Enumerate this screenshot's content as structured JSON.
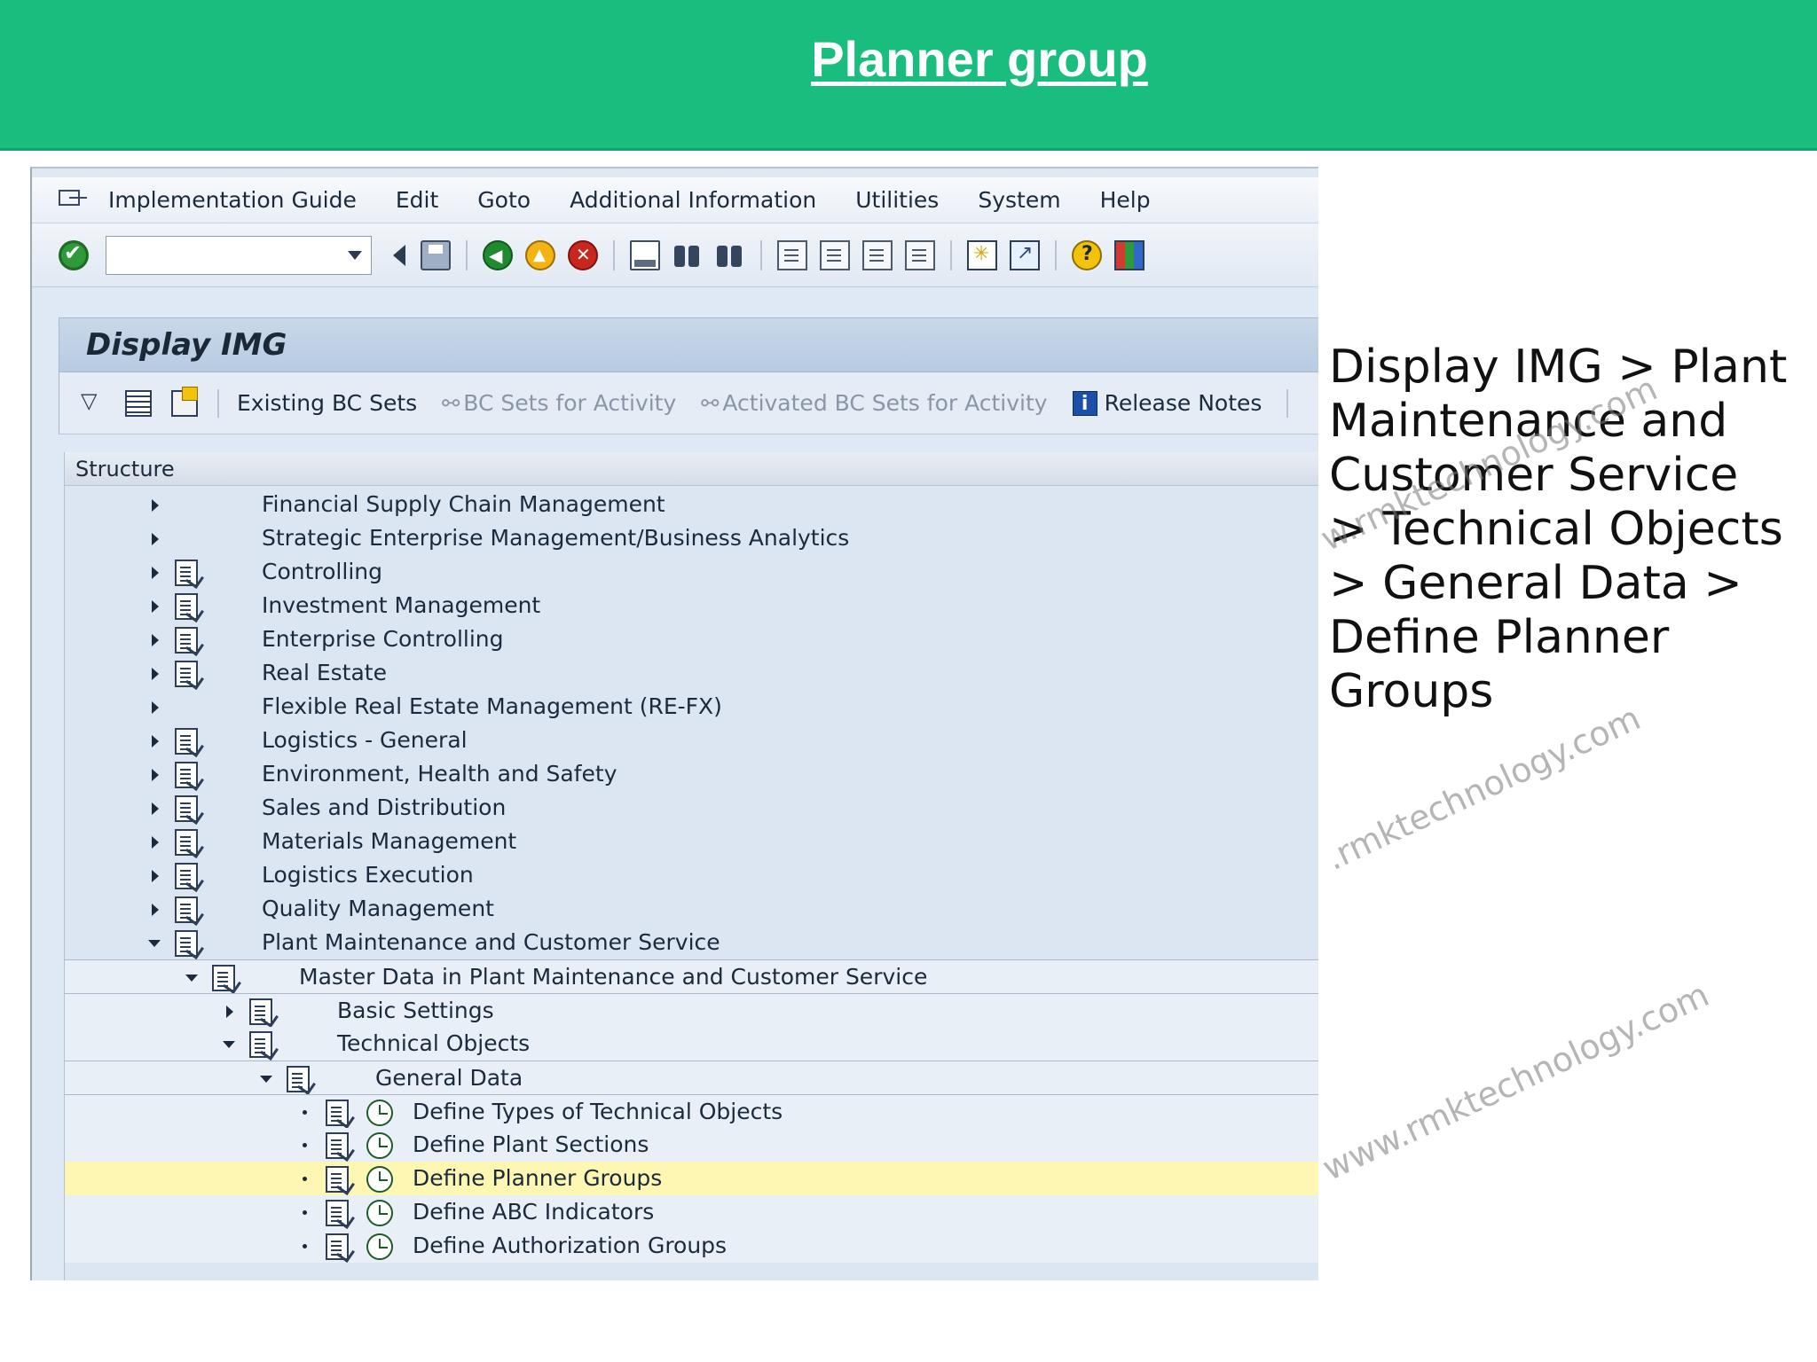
{
  "slide": {
    "title": "Planner group",
    "path_text": "Display IMG > Plant Maintenance and Customer Service > Technical Objects > General Data > Define Planner Groups",
    "watermark": "www.rmktechnology.com",
    "watermark_partial": ".rmktechnology.com",
    "watermark_partial2": "w.rmktechnology.com",
    "banner_color": "#19bd7d"
  },
  "menubar": {
    "items": [
      {
        "label": "Implementation Guide"
      },
      {
        "label": "Edit"
      },
      {
        "label": "Goto"
      },
      {
        "label": "Additional Information"
      },
      {
        "label": "Utilities"
      },
      {
        "label": "System"
      },
      {
        "label": "Help"
      }
    ]
  },
  "toolbar": {
    "command_field_value": ""
  },
  "screen": {
    "title": "Display IMG"
  },
  "app_toolbar": {
    "existing_bc_sets": "Existing BC Sets",
    "bc_sets_activity": "BC Sets for Activity",
    "activated_bc_sets": "Activated BC Sets for Activity",
    "release_notes": "Release Notes"
  },
  "tree": {
    "header": "Structure",
    "rows": [
      {
        "label": "Financial Supply Chain Management"
      },
      {
        "label": "Strategic Enterprise Management/Business Analytics"
      },
      {
        "label": "Controlling"
      },
      {
        "label": "Investment Management"
      },
      {
        "label": "Enterprise Controlling"
      },
      {
        "label": "Real Estate"
      },
      {
        "label": "Flexible Real Estate Management (RE-FX)"
      },
      {
        "label": "Logistics - General"
      },
      {
        "label": "Environment, Health and Safety"
      },
      {
        "label": "Sales and Distribution"
      },
      {
        "label": "Materials Management"
      },
      {
        "label": "Logistics Execution"
      },
      {
        "label": "Quality Management"
      },
      {
        "label": "Plant Maintenance and Customer Service"
      },
      {
        "label": "Master Data in Plant Maintenance and Customer Service"
      },
      {
        "label": "Basic Settings"
      },
      {
        "label": "Technical Objects"
      },
      {
        "label": "General Data"
      },
      {
        "label": "Define Types of Technical Objects"
      },
      {
        "label": "Define Plant Sections"
      },
      {
        "label": "Define Planner Groups"
      },
      {
        "label": "Define ABC Indicators"
      },
      {
        "label": "Define Authorization Groups"
      }
    ]
  }
}
